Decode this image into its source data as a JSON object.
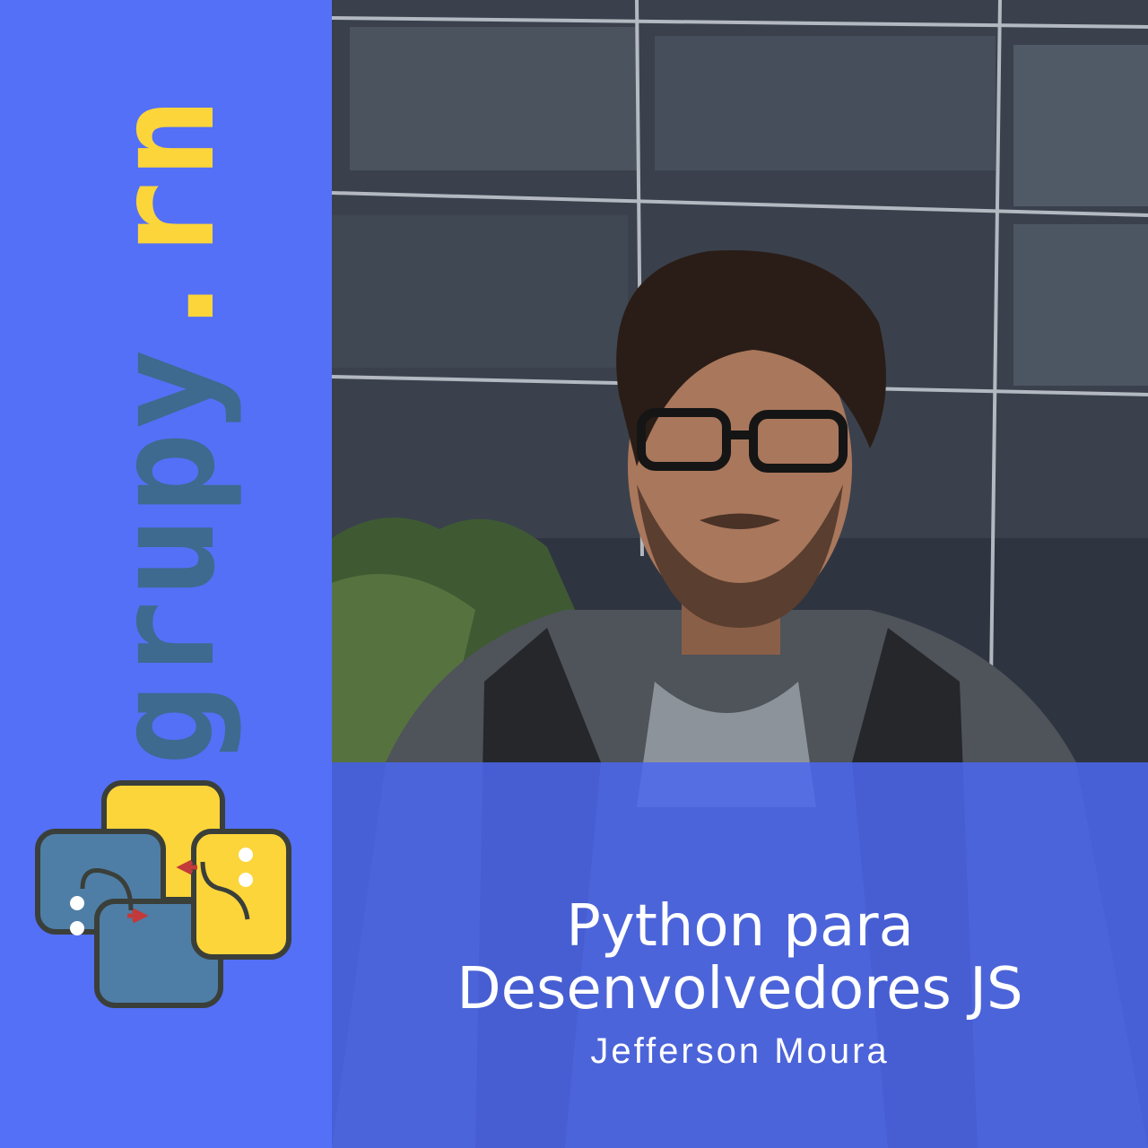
{
  "brand": {
    "name_start": "grupy",
    "name_dot": ".",
    "name_end": "rn",
    "logo_icon": "python-snakes-logo-icon"
  },
  "talk": {
    "title_line1": "Python para",
    "title_line2": "Desenvolvedores JS",
    "speaker": "Jefferson Moura"
  },
  "photo": {
    "subject": "speaker-photo"
  },
  "colors": {
    "background_blue": "#5470f6",
    "brand_dark": "#3d6a8e",
    "brand_yellow": "#fbd53a",
    "text": "#ffffff"
  }
}
